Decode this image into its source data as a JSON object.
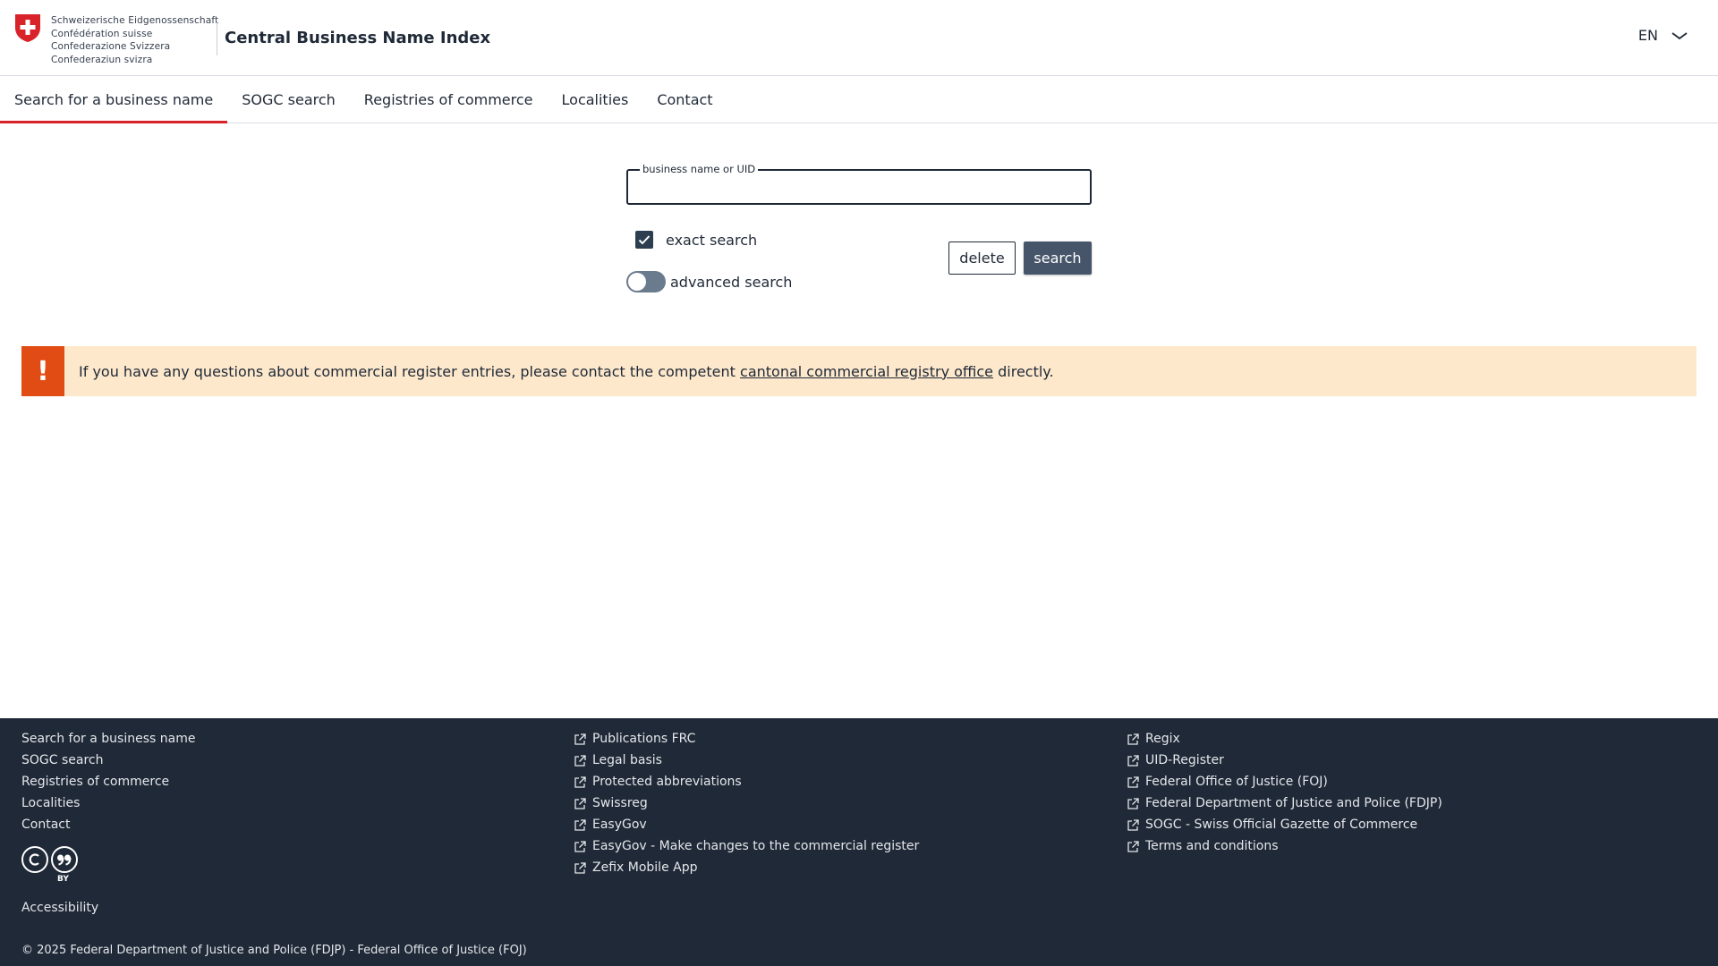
{
  "header": {
    "federation_lines": [
      "Schweizerische Eidgenossenschaft",
      "Confédération suisse",
      "Confederazione Svizzera",
      "Confederaziun svizra"
    ],
    "app_title": "Central Business Name Index",
    "language": "EN"
  },
  "nav": {
    "items": [
      {
        "label": "Search for a business name",
        "active": true
      },
      {
        "label": "SOGC search",
        "active": false
      },
      {
        "label": "Registries of commerce",
        "active": false
      },
      {
        "label": "Localities",
        "active": false
      },
      {
        "label": "Contact",
        "active": false
      }
    ]
  },
  "search": {
    "field_label": "business name or UID",
    "field_value": "",
    "exact_label": "exact search",
    "exact_checked": true,
    "advanced_label": "advanced search",
    "advanced_on": false,
    "delete_label": "delete",
    "search_label": "search"
  },
  "notice": {
    "icon": "!",
    "text_before": "If you have any questions about commercial register entries, please contact the competent",
    "link_text": "cantonal commercial registry office",
    "text_after": "directly."
  },
  "footer": {
    "col1": [
      "Search for a business name",
      "SOGC search",
      "Registries of commerce",
      "Localities",
      "Contact"
    ],
    "col2": [
      "Publications FRC",
      "Legal basis",
      "Protected abbreviations",
      "Swissreg",
      "EasyGov",
      "EasyGov - Make changes to the commercial register",
      "Zefix Mobile App"
    ],
    "col3": [
      "Regix",
      "UID-Register",
      "Federal Office of Justice (FOJ)",
      "Federal Department of Justice and Police (FDJP)",
      "SOGC - Swiss Official Gazette of Commerce",
      "Terms and conditions"
    ],
    "license_by": "BY",
    "accessibility": "Accessibility",
    "copyright": "© 2025 Federal Department of Justice and Police (FDJP) - Federal Office of Justice (FOJ)"
  },
  "colors": {
    "accent_red": "#d8232a",
    "notice_bg": "#fde8cc",
    "notice_icon": "#e14c15",
    "footer_bg": "#1f2937",
    "search_button": "#46556a"
  }
}
